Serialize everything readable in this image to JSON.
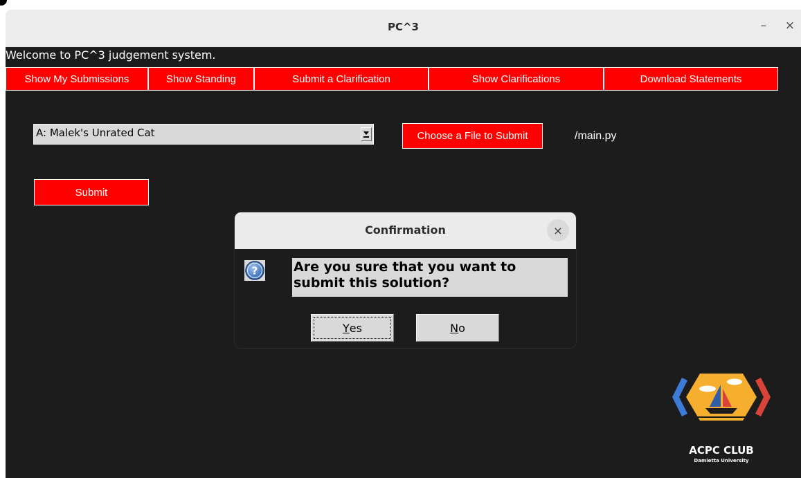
{
  "window": {
    "title": "PC^3",
    "minimize_glyph": "–",
    "close_glyph": "×"
  },
  "app": {
    "welcome": "Welcome to PC^3 judgement system.",
    "nav": [
      "Show My Submissions",
      "Show Standing",
      "Submit a Clarification",
      "Show Clarifications",
      "Download Statements"
    ],
    "problem_select": {
      "value": "A: Malek's Unrated Cat"
    },
    "choose_file_label": "Choose a File to Submit",
    "file_name": "/main.py",
    "submit_label": "Submit"
  },
  "dialog": {
    "title": "Confirmation",
    "close_glyph": "×",
    "message_line1": "Are you sure that you want to",
    "message_line2": "submit this solution?",
    "yes_mnemonic": "Y",
    "yes_rest": "es",
    "no_mnemonic": "N",
    "no_rest": "o",
    "icon": "question-icon"
  },
  "logo": {
    "name": "ACPC CLUB",
    "subtitle": "Damietta University"
  },
  "colors": {
    "accent": "#ff0000",
    "background": "#1c1c1c",
    "widget": "#d9d9d9"
  }
}
